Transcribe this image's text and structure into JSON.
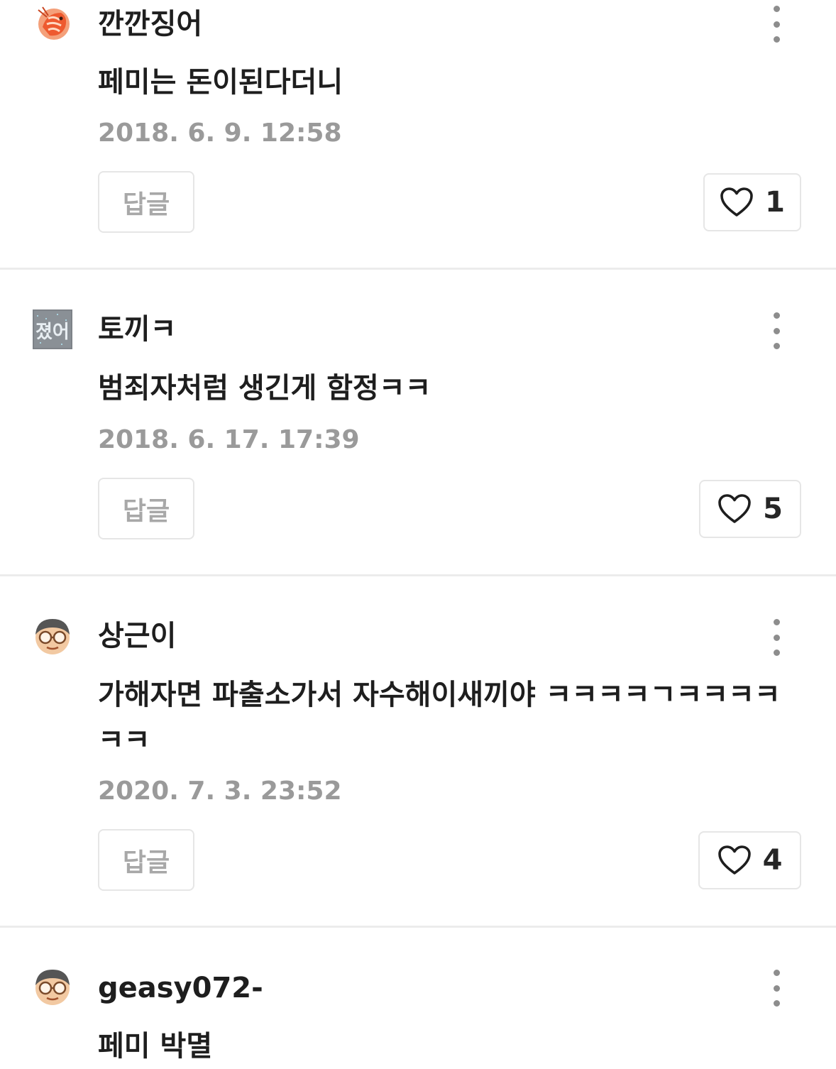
{
  "comments": [
    {
      "avatar_icon": "shrimp-avatar-icon",
      "nickname": "깐깐징어",
      "text": "페미는 돈이된다더니",
      "date": "2018. 6. 9. 12:58",
      "reply_label": "답글",
      "like_count": "1"
    },
    {
      "avatar_icon": "text-avatar-icon",
      "nickname": "토끼ㅋ",
      "text": "범죄자처럼 생긴게 함정ㅋㅋ",
      "date": "2018. 6. 17. 17:39",
      "reply_label": "답글",
      "like_count": "5"
    },
    {
      "avatar_icon": "glasses-face-avatar-icon",
      "nickname": "상근이",
      "text": "가해자면 파출소가서 자수해이새끼야 ㅋㅋㅋㅋㄱㅋㅋㅋㅋㅋㅋ",
      "date": "2020. 7. 3. 23:52",
      "reply_label": "답글",
      "like_count": "4"
    },
    {
      "avatar_icon": "glasses-face-avatar-icon",
      "nickname": "geasy072-",
      "text": "페미 박멸"
    }
  ],
  "icons": {
    "more": "more-vertical-icon",
    "like": "heart-outline-icon"
  },
  "colors": {
    "text": "#1e1e1e",
    "date": "#9a9a9a",
    "border": "#e6e6e6",
    "divider": "#ececec"
  }
}
